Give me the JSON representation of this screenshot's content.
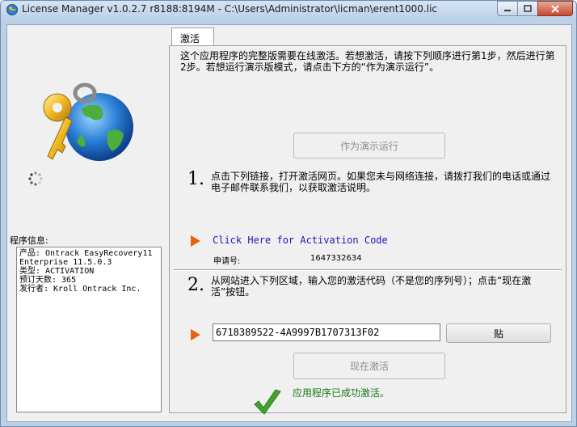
{
  "window": {
    "title": "License Manager v1.0.2.7 r8188:8194M - C:\\Users\\Administrator\\licman\\erent1000.lic"
  },
  "tab": {
    "label": "激活"
  },
  "intro": "这个应用程序的完整版需要在线激活。若想激活，请按下列顺序进行第1步，然后进行第2步。若想运行演示版模式，请点击下方的“作为演示运行”。",
  "demo_button": "作为演示运行",
  "step1": {
    "number": "1.",
    "text": "点击下列链接，打开激活网页。如果您未与网络连接，请拨打我们的电话或通过电子邮件联系我们，以获取激活说明。",
    "link": "Click Here for Activation Code",
    "request_label": "申请号:",
    "request_value": "1647332634"
  },
  "step2": {
    "number": "2.",
    "text": "从网站进入下列区域，输入您的激活代码（不是您的序列号）；点击“现在激活”按钮。",
    "code_value": "6718389522-4A9997B1707313F02",
    "paste_button": "贴",
    "activate_button": "现在激活",
    "success_text": "应用程序已成功激活。"
  },
  "program_info": {
    "label": "程序信息:",
    "lines": [
      "产品:  Ontrack EasyRecovery11",
      "Enterprise 11.5.0.3",
      "类型:  ACTIVATION",
      "预订天数:  365",
      "发行者:  Kroll Ontrack Inc."
    ]
  },
  "colors": {
    "arrow": "#e8600a",
    "link": "#1a1ab4",
    "success": "#1a7a1a",
    "check": "#3fa52c"
  }
}
